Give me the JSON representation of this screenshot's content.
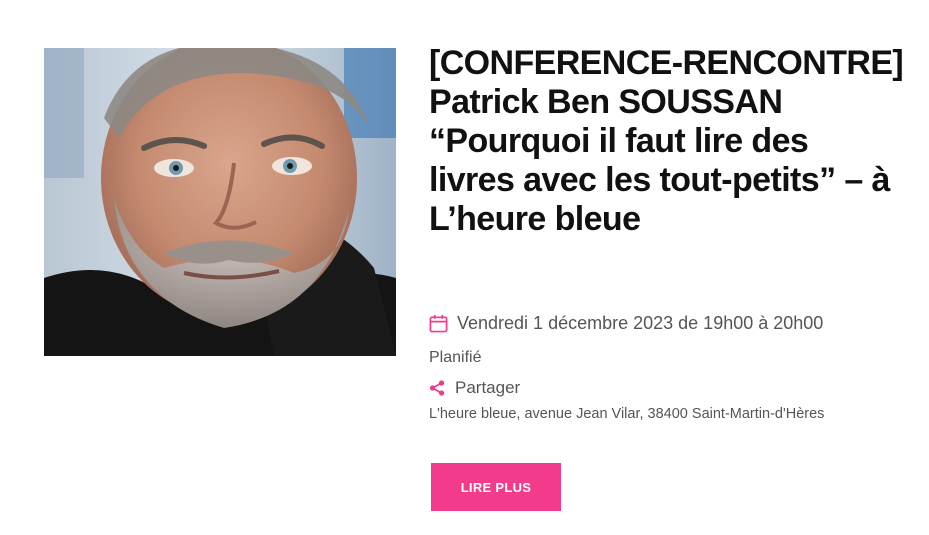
{
  "event": {
    "title_lines": [
      "[CONFERENCE-RENCONTRE]",
      "Patrick Ben SOUSSAN",
      "“Pourquoi il faut lire des",
      "livres avec les tout-petits” – à",
      "L’heure bleue"
    ],
    "date": "Vendredi 1 décembre 2023 de 19h00 à 20h00",
    "status": "Planifié",
    "share_label": "Partager",
    "address": "L'heure bleue, avenue Jean Vilar, 38400 Saint-Martin-d'Hères",
    "read_more_label": "LIRE PLUS"
  },
  "icons": {
    "date": "calendar-icon",
    "share": "share-icon"
  },
  "colors": {
    "accent": "#f43a8a",
    "title": "#111111",
    "meta": "#555555"
  }
}
